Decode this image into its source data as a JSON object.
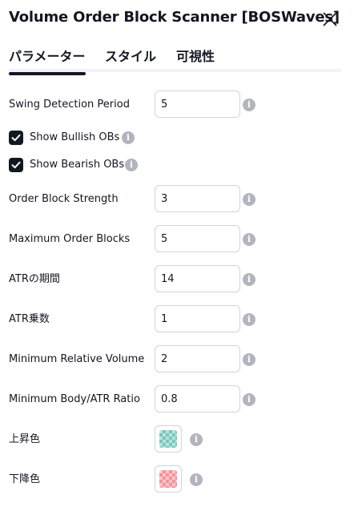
{
  "header": {
    "title": "Volume Order Block Scanner [BOSWaves]",
    "close_icon": "close-icon"
  },
  "tabs": [
    "パラメーター",
    "スタイル",
    "可視性"
  ],
  "active_tab": 0,
  "fields": {
    "swing": {
      "label": "Swing Detection Period",
      "value": "5"
    },
    "show_bullish": {
      "label": "Show Bullish OBs",
      "checked": true
    },
    "show_bearish": {
      "label": "Show Bearish OBs",
      "checked": true
    },
    "strength": {
      "label": "Order Block Strength",
      "value": "3"
    },
    "max_blocks": {
      "label": "Maximum Order Blocks",
      "value": "5"
    },
    "atr_period": {
      "label": "ATRの期間",
      "value": "14"
    },
    "atr_mult": {
      "label": "ATR乗数",
      "value": "1"
    },
    "min_rel_vol": {
      "label": "Minimum Relative Volume",
      "value": "2"
    },
    "min_body_atr": {
      "label": "Minimum Body/ATR Ratio",
      "value": "0.8"
    },
    "up_color": {
      "label": "上昇色",
      "color": "#089981"
    },
    "down_color": {
      "label": "下降色",
      "color": "#f23645"
    }
  },
  "info_icon_glyph": "i"
}
